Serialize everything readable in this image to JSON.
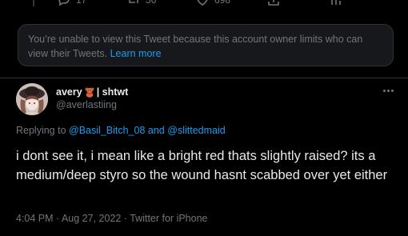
{
  "previous_tweet": {
    "actions": [
      {
        "name": "reply",
        "count": "17"
      },
      {
        "name": "retweet",
        "count": "36"
      },
      {
        "name": "like",
        "count": "698"
      },
      {
        "name": "share",
        "count": ""
      },
      {
        "name": "analytics",
        "count": ""
      }
    ]
  },
  "notice": {
    "text": "You’re unable to view this Tweet because this account owner limits who can view their Tweets.",
    "link": "Learn more"
  },
  "tweet": {
    "display_name": "avery",
    "name_emoji": "teddy-bear-icon",
    "name_suffix": "| shtwt",
    "handle": "@averlastiing",
    "replying_prefix": "Replying to",
    "mention_1": "@Basil_Bitch_08",
    "replying_and": "and",
    "mention_2": "@slittedmaid",
    "text": "i dont see it, i mean like a bright red thats slightly raised? its a medium/deep styro so the wound hasnt scabbed over yet either",
    "timestamp": "4:04 PM · Aug 27, 2022 · Twitter for iPhone"
  },
  "colors": {
    "background": "#000000",
    "text": "#e7e9ea",
    "secondary": "#71767b",
    "link": "#1d9bf0",
    "notice_bg": "#16181c",
    "border": "#2f3336"
  }
}
